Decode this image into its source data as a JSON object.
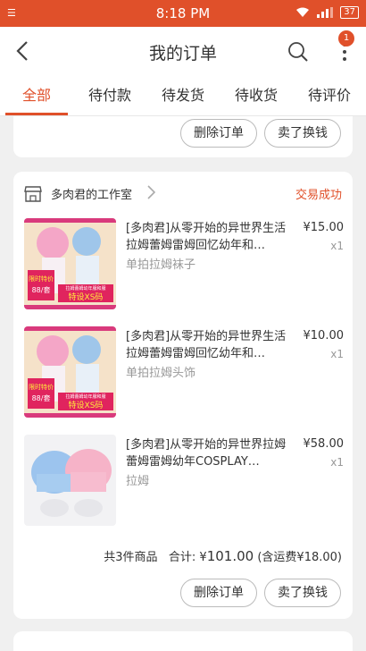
{
  "status_bar": {
    "time": "8:18 PM",
    "left_indicator": "☰",
    "battery": "37"
  },
  "nav": {
    "title": "我的订单",
    "badge": "1"
  },
  "tabs": [
    {
      "label": "全部"
    },
    {
      "label": "待付款"
    },
    {
      "label": "待发货"
    },
    {
      "label": "待收货"
    },
    {
      "label": "待评价"
    }
  ],
  "prev_card": {
    "delete_label": "删除订单",
    "resell_label": "卖了换钱"
  },
  "order": {
    "shop_name": "多肉君的工作室",
    "status": "交易成功",
    "items": [
      {
        "title": "[多肉君]从零开始的异世界生活拉姆蕾姆雷姆回忆幼年和…",
        "sku": "单拍拉姆袜子",
        "price": "¥15.00",
        "qty": "x1"
      },
      {
        "title": "[多肉君]从零开始的异世界生活拉姆蕾姆雷姆回忆幼年和…",
        "sku": "单拍拉姆头饰",
        "price": "¥10.00",
        "qty": "x1"
      },
      {
        "title": "[多肉君]从零开始的异世界拉姆蕾姆雷姆幼年COSPLAY…",
        "sku": "拉姆",
        "price": "¥58.00",
        "qty": "x1"
      }
    ],
    "summary_count": "共3件商品",
    "summary_total_label": "合计: ¥",
    "summary_total": "101.00",
    "summary_shipping": "(含运费¥18.00)",
    "delete_label": "删除订单",
    "resell_label": "卖了换钱"
  },
  "thumb_text": {
    "promo": "限时特价",
    "price": "88/套",
    "banner_top": "拉姆蕾姆幼年服和服",
    "banner_main": "特设XS码"
  },
  "colors": {
    "accent": "#e0502a"
  }
}
